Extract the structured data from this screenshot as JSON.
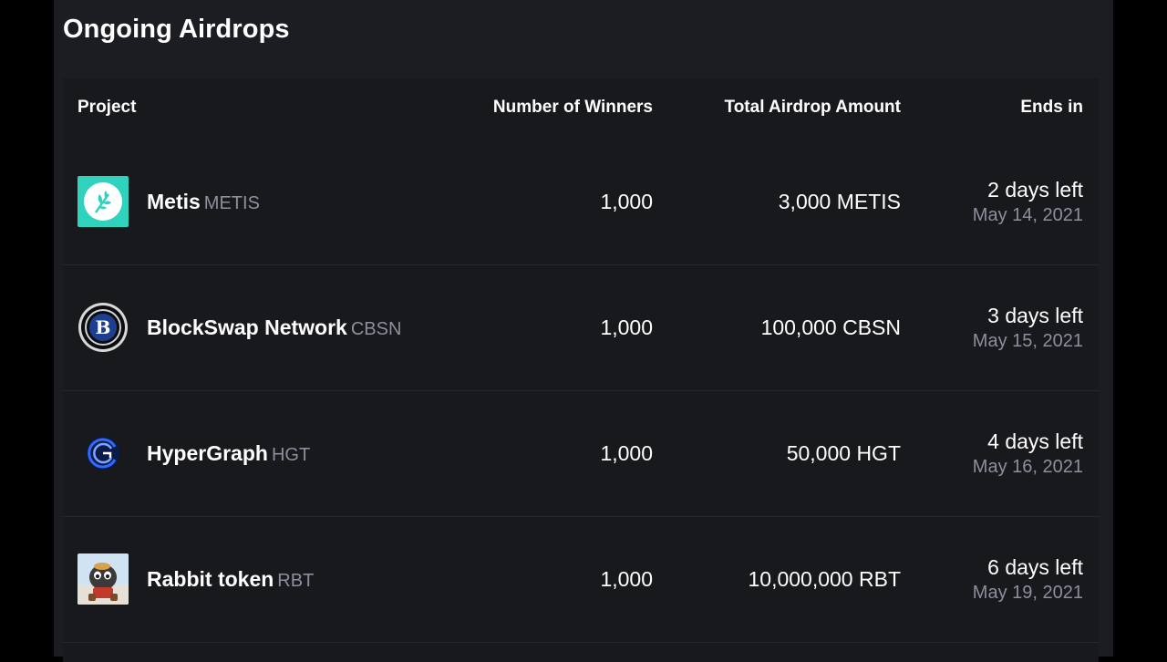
{
  "page": {
    "title": "Ongoing Airdrops"
  },
  "table": {
    "headers": {
      "project": "Project",
      "winners": "Number of Winners",
      "amount": "Total Airdrop Amount",
      "ends": "Ends in"
    },
    "rows": [
      {
        "name": "Metis",
        "symbol": "METIS",
        "winners": "1,000",
        "amount": "3,000 METIS",
        "days_left": "2 days left",
        "end_date": "May 14, 2021",
        "icon": "metis-logo-icon"
      },
      {
        "name": "BlockSwap Network",
        "symbol": "CBSN",
        "winners": "1,000",
        "amount": "100,000 CBSN",
        "days_left": "3 days left",
        "end_date": "May 15, 2021",
        "icon": "blockswap-logo-icon"
      },
      {
        "name": "HyperGraph",
        "symbol": "HGT",
        "winners": "1,000",
        "amount": "50,000 HGT",
        "days_left": "4 days left",
        "end_date": "May 16, 2021",
        "icon": "hypergraph-logo-icon"
      },
      {
        "name": "Rabbit token",
        "symbol": "RBT",
        "winners": "1,000",
        "amount": "10,000,000 RBT",
        "days_left": "6 days left",
        "end_date": "May 19, 2021",
        "icon": "rabbit-token-logo-icon"
      }
    ]
  },
  "colors": {
    "background": "#000000",
    "panel": "#1c1d22",
    "table": "#18191d",
    "text_primary": "#ffffff",
    "text_muted": "#8b909c",
    "metis_accent": "#2fd2bd",
    "hypergraph_accent": "#2f6bff"
  }
}
